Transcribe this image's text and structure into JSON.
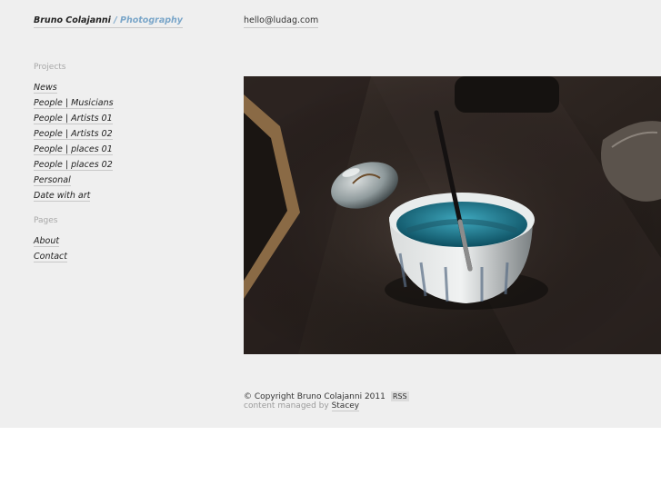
{
  "header": {
    "name": "Bruno Colajanni",
    "separator": "/",
    "subtitle": "Photography",
    "email": "hello@ludag.com"
  },
  "nav": {
    "projects_heading": "Projects",
    "projects": [
      {
        "label": "News"
      },
      {
        "label": "People | Musicians"
      },
      {
        "label": "People | Artists 01"
      },
      {
        "label": "People | Artists 02"
      },
      {
        "label": "People | places 01"
      },
      {
        "label": "People | places 02"
      },
      {
        "label": "Personal"
      },
      {
        "label": "Date with art"
      }
    ],
    "pages_heading": "Pages",
    "pages": [
      {
        "label": "About"
      },
      {
        "label": "Contact"
      }
    ]
  },
  "footer": {
    "copyright": "© Copyright Bruno Colajanni 2011",
    "rss": "RSS",
    "managed_prefix": "content managed by",
    "managed_link": "Stacey"
  },
  "colors": {
    "background": "#efefef",
    "accent": "#7aa6c9",
    "text": "#222222",
    "muted": "#a8a8a8"
  }
}
